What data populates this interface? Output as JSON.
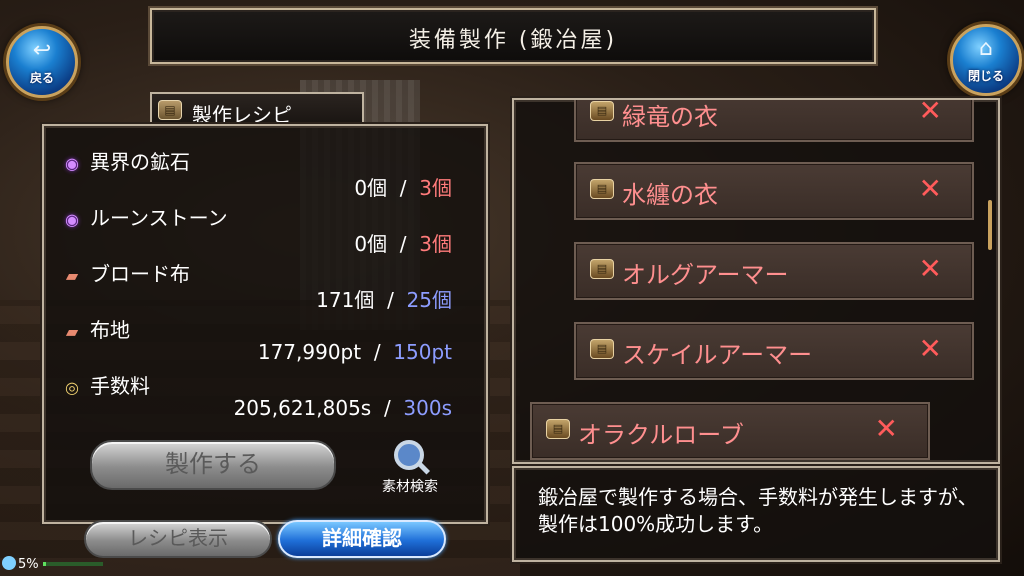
{
  "header": {
    "title": "装備製作 (鍛冶屋)"
  },
  "nav": {
    "back_icon": "back-arrow-icon",
    "back_label": "戻る",
    "close_icon": "home-icon",
    "close_label": "閉じる"
  },
  "recipe": {
    "tab_label": "製作レシピ",
    "materials": [
      {
        "icon": "gem-icon",
        "name": "異界の鉱石",
        "have": "0個",
        "sep": "/",
        "need": "3個",
        "need_color": "red"
      },
      {
        "icon": "gem-icon",
        "name": "ルーンストーン",
        "have": "0個",
        "sep": "/",
        "need": "3個",
        "need_color": "red"
      },
      {
        "icon": "cloth-icon",
        "name": "ブロード布",
        "have": "171個",
        "sep": "/",
        "need": "25個",
        "need_color": "blue"
      },
      {
        "icon": "cloth-icon",
        "name": "布地",
        "have": "177,990pt",
        "sep": "/",
        "need": "150pt",
        "need_color": "blue"
      },
      {
        "icon": "coin-icon",
        "name": "手数料",
        "have": "205,621,805s",
        "sep": "/",
        "need": "300s",
        "need_color": "blue"
      }
    ],
    "craft_label": "製作する",
    "search_label": "素材検索"
  },
  "bottom_buttons": {
    "recipe_show": "レシピ表示",
    "detail": "詳細確認"
  },
  "equipment_list": [
    {
      "name": "緑竜の衣",
      "status": "✕"
    },
    {
      "name": "水纏の衣",
      "status": "✕"
    },
    {
      "name": "オルグアーマー",
      "status": "✕"
    },
    {
      "name": "スケイルアーマー",
      "status": "✕"
    },
    {
      "name": "オラクルローブ",
      "status": "✕",
      "selected": true
    }
  ],
  "info": {
    "text": "鍛冶屋で製作する場合、手数料が発生しますが、製作は100%成功します。"
  },
  "status_bar": {
    "battery": "5%",
    "battery_level": 0.05
  },
  "colors": {
    "need_red": "#ff7b7b",
    "need_blue": "#8d9dff",
    "item_name": "#ff8f8f",
    "x_mark": "#ff5b5b"
  }
}
